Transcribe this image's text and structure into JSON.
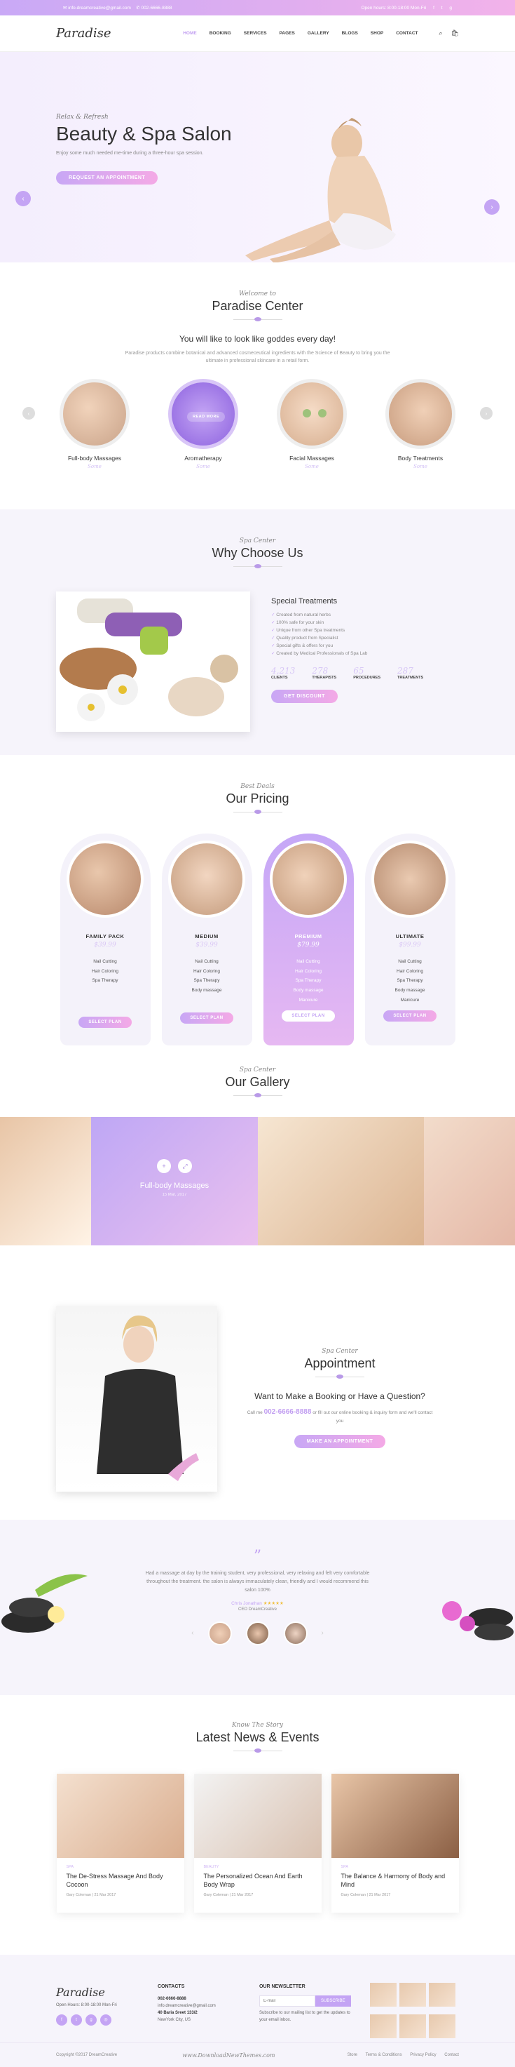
{
  "topbar": {
    "email": "info.dreamcreative@gmail.com",
    "phone": "002-6666-8888",
    "hours": "Open hours: 8:00-18:00 Mon-Fri",
    "social": [
      "f",
      "t",
      "g"
    ]
  },
  "header": {
    "logo": "Paradise",
    "nav": [
      "HOME",
      "BOOKING",
      "SERVICES",
      "PAGES",
      "GALLERY",
      "BLOGS",
      "SHOP",
      "CONTACT"
    ]
  },
  "hero": {
    "script": "Relax & Refresh",
    "title": "Beauty & Spa Salon",
    "subtitle": "Enjoy some much needed me-time during a three-hour spa session.",
    "button": "REQUEST AN APPOINTMENT",
    "prev": "‹",
    "next": "›"
  },
  "paradise": {
    "script": "Welcome to",
    "title": "Paradise Center",
    "lead": "You will like to look like goddes every day!",
    "desc": "Paradise products combine botanical and advanced cosmeceutical ingredients with the Science of Beauty to bring you the ultimate in professional skincare in a retail form.",
    "services": [
      {
        "name": "Full-body Massages",
        "sub": "Some"
      },
      {
        "name": "Aromatherapy",
        "sub": "Some",
        "button": "READ MORE"
      },
      {
        "name": "Facial Massages",
        "sub": "Some"
      },
      {
        "name": "Body Treatments",
        "sub": "Some"
      }
    ]
  },
  "why": {
    "script": "Spa Center",
    "title": "Why Choose Us",
    "heading": "Special Treatments",
    "items": [
      "Created from natural herbs",
      "100% safe for your skin",
      "Unique from other Spa treatments",
      "Quality product from Specialist",
      "Special gifts & offers for you",
      "Created by Medical Professionals of Spa Lab"
    ],
    "stats": [
      {
        "num": "4,213",
        "label": "CLIENTS"
      },
      {
        "num": "278",
        "label": "THERAPISTS"
      },
      {
        "num": "65",
        "label": "PROCEDURES"
      },
      {
        "num": "287",
        "label": "TREATMENTS"
      }
    ],
    "button": "GET DISCOUNT"
  },
  "pricing": {
    "script": "Best Deals",
    "title": "Our Pricing",
    "plans": [
      {
        "name": "FAMILY PACK",
        "price": "$39.99",
        "features": [
          "Nail Cutting",
          "Hair Coloring",
          "Spa Therapy"
        ],
        "button": "SELECT PLAN"
      },
      {
        "name": "MEDIUM",
        "price": "$39.99",
        "features": [
          "Nail Cutting",
          "Hair Coloring",
          "Spa Therapy",
          "Body massage"
        ],
        "button": "SELECT PLAN"
      },
      {
        "name": "PREMIUM",
        "price": "$79.99",
        "features": [
          "Nail Cutting",
          "Hair Coloring",
          "Spa Therapy",
          "Body massage",
          "Manicure"
        ],
        "button": "SELECT PLAN"
      },
      {
        "name": "ULTIMATE",
        "price": "$99.99",
        "features": [
          "Nail Cutting",
          "Hair Coloring",
          "Spa Therapy",
          "Body massage",
          "Manicure"
        ],
        "button": "SELECT PLAN"
      }
    ]
  },
  "gallery": {
    "script": "Spa Center",
    "title": "Our Gallery",
    "overlay_title": "Full-body Massages",
    "overlay_date": "15 Mar, 2017",
    "icons": [
      "+",
      "⤢"
    ]
  },
  "appointment": {
    "script": "Spa Center",
    "title": "Appointment",
    "question": "Want to Make a Booking or Have a Question?",
    "call_prefix": "Call me",
    "phone": "002-6666-8888",
    "call_suffix": "or fill out our online booking & inquiry form and we'll contact you",
    "button": "MAKE AN APPOINTMENT"
  },
  "testimonial": {
    "quote_mark": "”",
    "text": "Had a massage at day by the training student, very professional, very relaxing and felt very comfortable throughout the treatment. the salon is always immaculately clean, friendly and I would recommend this salon 100%",
    "name": "Chris Jonathan",
    "stars": "★★★★★",
    "role": "CEO DreamCreative"
  },
  "news": {
    "script": "Know The Story",
    "title": "Latest News & Events",
    "cards": [
      {
        "tag": "SPA",
        "title": "The De-Stress Massage And Body Cocoon",
        "meta": "Gary Coleman  |  21 Mar 2017"
      },
      {
        "tag": "BEAUTY",
        "title": "The Personalized Ocean And Earth Body Wrap",
        "meta": "Gary Coleman  |  21 Mar 2017"
      },
      {
        "tag": "SPA",
        "title": "The Balance & Harmony of Body and Mind",
        "meta": "Gary Coleman  |  21 Mar 2017"
      }
    ]
  },
  "footer": {
    "logo": "Paradise",
    "hours": "Open Hours: 8:00-18:00 Mon-Fri",
    "contacts_title": "CONTACTS",
    "phone": "002-6666-8888",
    "email": "info.dreamcreative@gmail.com",
    "address1": "40 Baria Sreet 133/2",
    "address2": "NewYork City, US",
    "newsletter_title": "OUR NEWSLETTER",
    "newsletter_placeholder": "E-mail",
    "newsletter_button": "SUBSCRIBE",
    "newsletter_note": "Subscribe to our mailing list to get the updates to your email inbox.",
    "copyright": "Copyright ©2017 DreamCreative",
    "links": [
      "Store",
      "Terms & Conditions",
      "Privacy Policy",
      "Contact"
    ]
  },
  "watermark": "www.DownloadNewThemes.com"
}
